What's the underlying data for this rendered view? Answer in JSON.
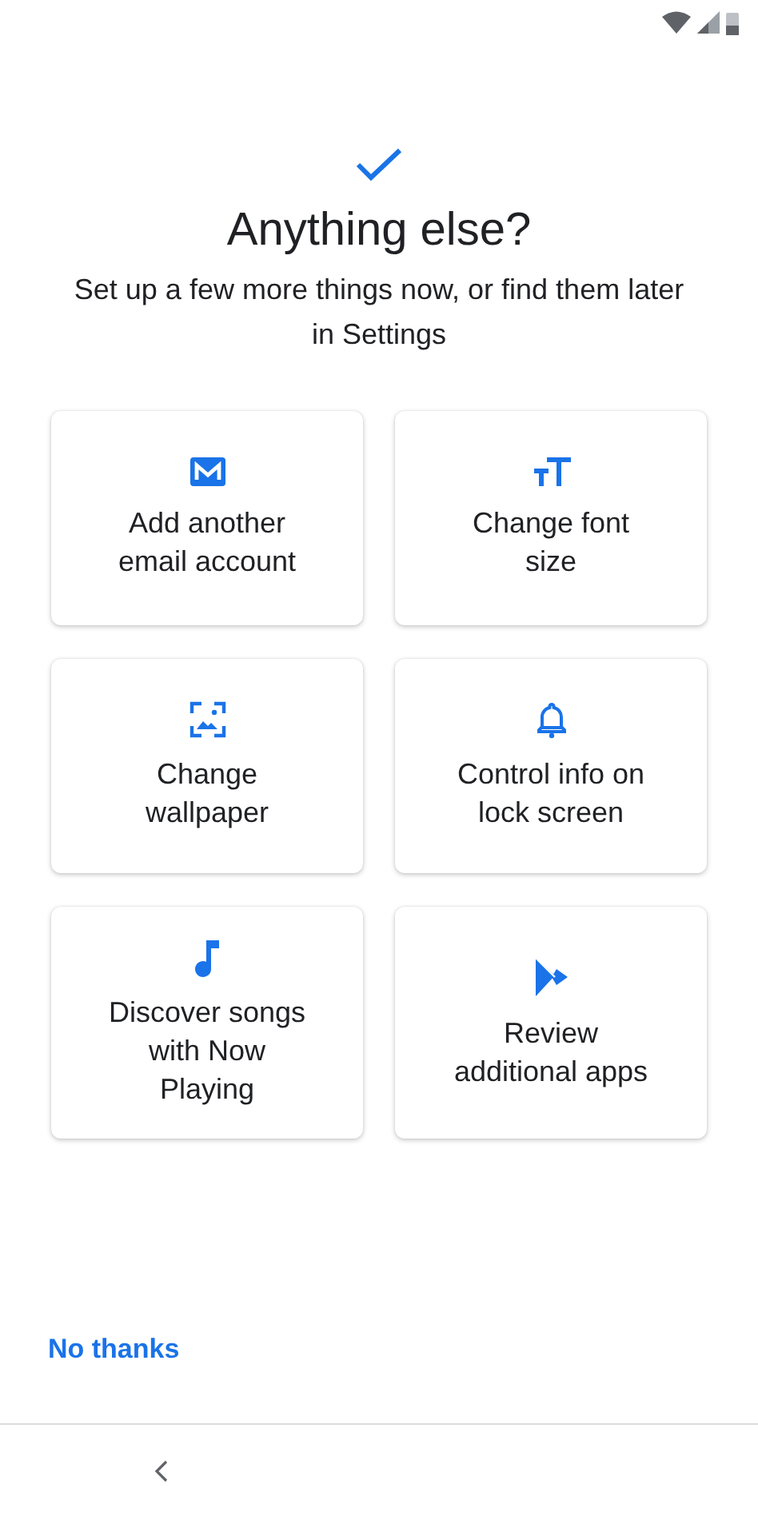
{
  "title": "Anything else?",
  "subtitle": "Set up a few more things now, or find them later in Settings",
  "options": [
    {
      "kind": "email",
      "label": "Add another email account"
    },
    {
      "kind": "font",
      "label": "Change font size"
    },
    {
      "kind": "wallpaper",
      "label": "Change wallpaper"
    },
    {
      "kind": "bell",
      "label": "Control info on lock screen"
    },
    {
      "kind": "music",
      "label": "Discover songs with Now Playing"
    },
    {
      "kind": "play",
      "label": "Review additional apps"
    }
  ],
  "skip_button": "No thanks"
}
